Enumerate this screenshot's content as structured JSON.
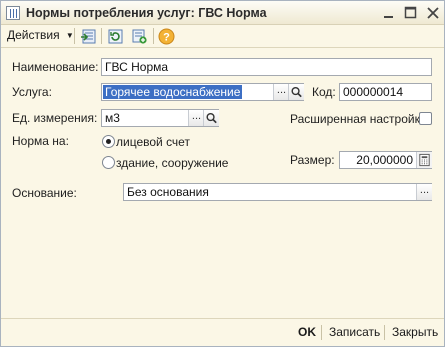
{
  "window": {
    "title": "Нормы потребления услуг: ГВС Норма"
  },
  "toolbar": {
    "actions_label": "Действия",
    "icons": [
      "move-in-icon",
      "refresh-icon",
      "copy-icon",
      "help-icon"
    ]
  },
  "form": {
    "name_label": "Наименование:",
    "name_value": "ГВС Норма",
    "service_label": "Услуга:",
    "service_value": "Горячее водоснабжение",
    "code_label": "Код:",
    "code_value": "000000014",
    "unit_label": "Ед. измерения:",
    "unit_value": "м3",
    "advanced_label": "Расширенная настройка",
    "advanced_checked": false,
    "norm_label": "Норма на:",
    "norm_options": [
      {
        "label": "лицевой счет",
        "selected": true
      },
      {
        "label": "здание, сооружение",
        "selected": false
      }
    ],
    "size_label": "Размер:",
    "size_value": "20,000000",
    "basis_label": "Основание:",
    "basis_value": "Без основания"
  },
  "footer": {
    "ok_label": "OK",
    "save_label": "Записать",
    "close_label": "Закрыть"
  },
  "colors": {
    "window_bg": "#fbf7e6",
    "selection": "#3d6fc4",
    "help_icon": "#e89a1c"
  }
}
